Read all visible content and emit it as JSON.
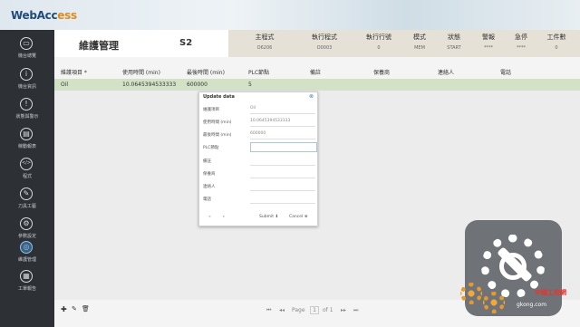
{
  "app": {
    "logo_main": "WebAcc",
    "logo_accent": "ess"
  },
  "sidebar": {
    "items": [
      {
        "label": "機台總覽",
        "icon": "monitor-icon",
        "glyph": "▭"
      },
      {
        "label": "機台資訊",
        "icon": "info-icon",
        "glyph": "i"
      },
      {
        "label": "狀態與警示",
        "icon": "alert-icon",
        "glyph": "!"
      },
      {
        "label": "稼動報表",
        "icon": "chart-icon",
        "glyph": "▤"
      },
      {
        "label": "程式",
        "icon": "code-icon",
        "glyph": "</>"
      },
      {
        "label": "刀具工藝",
        "icon": "tool-icon",
        "glyph": "✎"
      },
      {
        "label": "參數設定",
        "icon": "settings-icon",
        "glyph": "⚙"
      },
      {
        "label": "維護管理",
        "icon": "maintenance-icon",
        "glyph": "◎"
      },
      {
        "label": "工單報告",
        "icon": "report-icon",
        "glyph": "▦"
      }
    ]
  },
  "header": {
    "title": "維護管理",
    "machine": "S2",
    "status": [
      {
        "label": "主程式",
        "value": "O6206"
      },
      {
        "label": "執行程式",
        "value": "O0003"
      },
      {
        "label": "執行行號",
        "value": "0"
      },
      {
        "label": "模式",
        "value": "MEM"
      },
      {
        "label": "狀態",
        "value": "START"
      },
      {
        "label": "警報",
        "value": "****"
      },
      {
        "label": "急停",
        "value": "****"
      },
      {
        "label": "工件數",
        "value": "0"
      }
    ]
  },
  "table": {
    "columns": [
      "維護項目 *",
      "使用時間 (min)",
      "最後時間 (min)",
      "PLC節點",
      "備註",
      "保養商",
      "連絡人",
      "電話"
    ],
    "rows": [
      [
        "Oil",
        "10.0645394533333",
        "600000",
        "5",
        "",
        "",
        "",
        ""
      ]
    ]
  },
  "dialog": {
    "title": "Update data",
    "fields": [
      {
        "label": "維護項目",
        "value": "Oil"
      },
      {
        "label": "使用時間 (min)",
        "value": "10.0645394533333"
      },
      {
        "label": "最後時間 (min)",
        "value": "600000"
      },
      {
        "label": "PLC節點",
        "value": ""
      },
      {
        "label": "備註",
        "value": ""
      },
      {
        "label": "保養商",
        "value": ""
      },
      {
        "label": "連絡人",
        "value": ""
      },
      {
        "label": "電話",
        "value": ""
      }
    ],
    "submit_label": "Submit",
    "cancel_label": "Cancel"
  },
  "pager": {
    "page_label": "Page",
    "page_value": "1",
    "of_label": "of 1"
  },
  "watermark": {
    "text": "gkong.com",
    "brand": "中國工控網"
  }
}
